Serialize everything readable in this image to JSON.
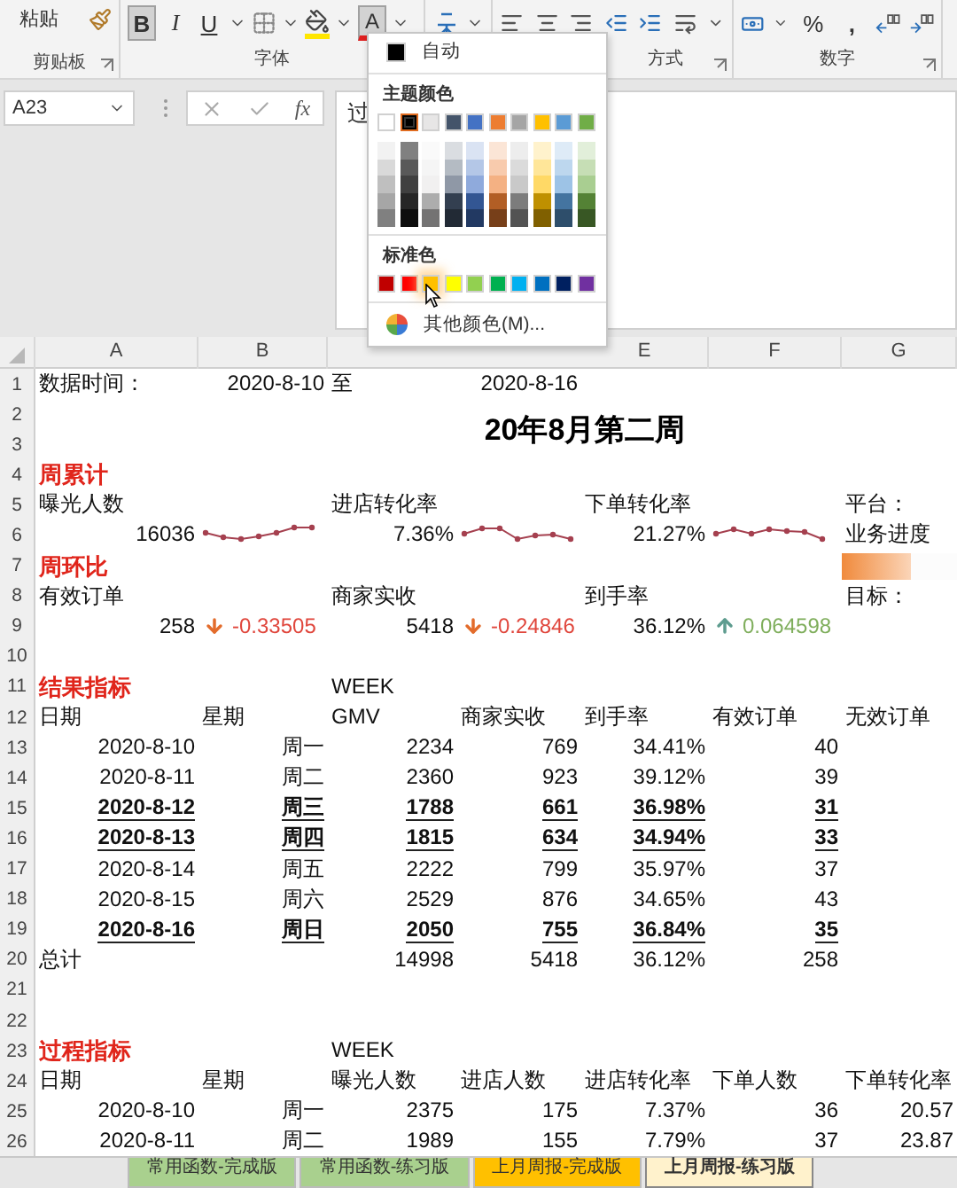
{
  "ribbon": {
    "paste_label": "粘贴",
    "font_buttons": [
      {
        "label": "B",
        "pressed": true
      },
      {
        "label": "I",
        "pressed": false
      },
      {
        "label": "U",
        "pressed": false
      }
    ],
    "font_color_label": "A",
    "percent_label": "%",
    "comma_label": ",",
    "groups": [
      {
        "label": "剪贴板"
      },
      {
        "label": "字体"
      },
      {
        "label": "方式"
      },
      {
        "label": "数字"
      }
    ]
  },
  "formula_bar": {
    "name_box": "A23",
    "fx_label": "fx",
    "formula": "过"
  },
  "color_menu": {
    "auto_label": "自动",
    "theme_title": "主题颜色",
    "theme_colors": [
      {
        "color": "#ffffff",
        "selected": false
      },
      {
        "color": "#000000",
        "selected": true
      },
      {
        "color": "#e7e6e6",
        "selected": false
      },
      {
        "color": "#44546a",
        "selected": false
      },
      {
        "color": "#4472c4",
        "selected": false
      },
      {
        "color": "#ed7d31",
        "selected": false
      },
      {
        "color": "#a5a5a5",
        "selected": false
      },
      {
        "color": "#ffc000",
        "selected": false
      },
      {
        "color": "#5b9bd5",
        "selected": false
      },
      {
        "color": "#70ad47",
        "selected": false
      }
    ],
    "standard_title": "标准色",
    "standard_colors": [
      {
        "color": "#c00000",
        "hovered": false
      },
      {
        "color": "#ff0000",
        "hovered": false
      },
      {
        "color": "#ffc000",
        "hovered": true
      },
      {
        "color": "#ffff00",
        "hovered": false
      },
      {
        "color": "#92d050",
        "hovered": false
      },
      {
        "color": "#00b050",
        "hovered": false
      },
      {
        "color": "#00b0f0",
        "hovered": false
      },
      {
        "color": "#0070c0",
        "hovered": false
      },
      {
        "color": "#002060",
        "hovered": false
      },
      {
        "color": "#7030a0",
        "hovered": false
      }
    ],
    "more_label": "其他颜色(M)..."
  },
  "column_headers": [
    "A",
    "B",
    "E",
    "F",
    "G"
  ],
  "rows": [
    {
      "num": "1",
      "highlighted": false,
      "cells": [
        {
          "kind": "label",
          "text": "数据时间："
        },
        {
          "kind": "number",
          "text": "2020-8-10"
        },
        {
          "kind": "label",
          "text": "至"
        },
        {
          "kind": "number",
          "text": "2020-8-16"
        }
      ]
    },
    {
      "num": "2",
      "cells": [
        {
          "kind": "empty"
        },
        {
          "kind": "empty"
        },
        {
          "kind": "title",
          "text": "20年8月第二周"
        }
      ]
    },
    {
      "num": "3"
    },
    {
      "num": "4",
      "cells": [
        {
          "kind": "heading",
          "text": "周累计"
        }
      ]
    },
    {
      "num": "5",
      "cells": [
        {
          "kind": "label",
          "text": "曝光人数"
        },
        {
          "kind": "empty"
        },
        {
          "kind": "label",
          "text": "进店转化率"
        },
        {
          "kind": "empty"
        },
        {
          "kind": "label",
          "text": "下单转化率"
        },
        {
          "kind": "empty"
        },
        {
          "kind": "label",
          "text": "平台："
        }
      ]
    },
    {
      "num": "6",
      "highlighted": false,
      "cells": [
        {
          "kind": "number",
          "text": "16036"
        },
        {
          "kind": "sparkline"
        },
        {
          "kind": "number",
          "text": "7.36%"
        },
        {
          "kind": "sparkline"
        },
        {
          "kind": "number",
          "text": "21.27%"
        },
        {
          "kind": "sparkline"
        },
        {
          "kind": "label",
          "text": "业务进度"
        }
      ]
    },
    {
      "num": "7",
      "cells": [
        {
          "kind": "heading",
          "text": "周环比"
        },
        {
          "kind": "empty"
        },
        {
          "kind": "empty"
        },
        {
          "kind": "empty"
        },
        {
          "kind": "empty"
        },
        {
          "kind": "empty"
        },
        {
          "kind": "databar",
          "level": 0.6
        }
      ]
    },
    {
      "num": "8",
      "cells": [
        {
          "kind": "label",
          "text": "有效订单"
        },
        {
          "kind": "empty"
        },
        {
          "kind": "label",
          "text": "商家实收"
        },
        {
          "kind": "empty"
        },
        {
          "kind": "label",
          "text": "到手率"
        },
        {
          "kind": "empty"
        },
        {
          "kind": "label",
          "text": "目标："
        }
      ]
    },
    {
      "num": "9",
      "highlighted": false,
      "cells": [
        {
          "kind": "number",
          "text": "258"
        },
        {
          "kind": "decrease",
          "color": "#e0463c",
          "text": "-0.33505"
        },
        {
          "kind": "number",
          "text": "5418"
        },
        {
          "kind": "decrease",
          "color": "#e0463c",
          "text": "-0.24846"
        },
        {
          "kind": "number",
          "text": "36.12%"
        },
        {
          "kind": "increase",
          "color": "#7fae5c",
          "text": "0.064598"
        }
      ]
    },
    {
      "num": "10"
    },
    {
      "num": "11",
      "cells": [
        {
          "kind": "heading",
          "text": "结果指标"
        },
        {
          "kind": "empty"
        },
        {
          "kind": "label",
          "text": "WEEK"
        }
      ]
    },
    {
      "num": "12",
      "cells": [
        {
          "kind": "label",
          "text": "日期"
        },
        {
          "kind": "label",
          "text": "星期"
        },
        {
          "kind": "label",
          "text": "GMV"
        },
        {
          "kind": "label",
          "text": "商家实收"
        },
        {
          "kind": "label",
          "text": "到手率"
        },
        {
          "kind": "label",
          "text": "有效订单"
        },
        {
          "kind": "label",
          "text": "无效订单"
        }
      ]
    },
    {
      "num": "13",
      "highlighted": false,
      "cells": [
        {
          "kind": "number",
          "text": "2020-8-10"
        },
        {
          "kind": "number",
          "text": "周一"
        },
        {
          "kind": "number",
          "text": "2234"
        },
        {
          "kind": "number",
          "text": "769"
        },
        {
          "kind": "number",
          "text": "34.41%"
        },
        {
          "kind": "number",
          "text": "40"
        }
      ]
    },
    {
      "num": "14",
      "highlighted": false,
      "cells": [
        {
          "kind": "number",
          "text": "2020-8-11"
        },
        {
          "kind": "number",
          "text": "周二"
        },
        {
          "kind": "number",
          "text": "2360"
        },
        {
          "kind": "number",
          "text": "923"
        },
        {
          "kind": "number",
          "text": "39.12%"
        },
        {
          "kind": "number",
          "text": "39"
        }
      ]
    },
    {
      "num": "15",
      "highlighted": true,
      "cells": [
        {
          "kind": "number",
          "text": "2020-8-12"
        },
        {
          "kind": "number",
          "text": "周三"
        },
        {
          "kind": "number",
          "text": "1788"
        },
        {
          "kind": "number",
          "text": "661"
        },
        {
          "kind": "number",
          "text": "36.98%"
        },
        {
          "kind": "number",
          "text": "31"
        }
      ]
    },
    {
      "num": "16",
      "highlighted": true,
      "cells": [
        {
          "kind": "number",
          "text": "2020-8-13"
        },
        {
          "kind": "number",
          "text": "周四"
        },
        {
          "kind": "number",
          "text": "1815"
        },
        {
          "kind": "number",
          "text": "634"
        },
        {
          "kind": "number",
          "text": "34.94%"
        },
        {
          "kind": "number",
          "text": "33"
        }
      ]
    },
    {
      "num": "17",
      "highlighted": false,
      "cells": [
        {
          "kind": "number",
          "text": "2020-8-14"
        },
        {
          "kind": "number",
          "text": "周五"
        },
        {
          "kind": "number",
          "text": "2222"
        },
        {
          "kind": "number",
          "text": "799"
        },
        {
          "kind": "number",
          "text": "35.97%"
        },
        {
          "kind": "number",
          "text": "37"
        }
      ]
    },
    {
      "num": "18",
      "highlighted": false,
      "cells": [
        {
          "kind": "number",
          "text": "2020-8-15"
        },
        {
          "kind": "number",
          "text": "周六"
        },
        {
          "kind": "number",
          "text": "2529"
        },
        {
          "kind": "number",
          "text": "876"
        },
        {
          "kind": "number",
          "text": "34.65%"
        },
        {
          "kind": "number",
          "text": "43"
        }
      ]
    },
    {
      "num": "19",
      "highlighted": true,
      "cells": [
        {
          "kind": "number",
          "text": "2020-8-16"
        },
        {
          "kind": "number",
          "text": "周日"
        },
        {
          "kind": "number",
          "text": "2050"
        },
        {
          "kind": "number",
          "text": "755"
        },
        {
          "kind": "number",
          "text": "36.84%"
        },
        {
          "kind": "number",
          "text": "35"
        }
      ]
    },
    {
      "num": "20",
      "highlighted": false,
      "cells": [
        {
          "kind": "label",
          "text": "总计"
        },
        {
          "kind": "empty"
        },
        {
          "kind": "number",
          "text": "14998"
        },
        {
          "kind": "number",
          "text": "5418"
        },
        {
          "kind": "number",
          "text": "36.12%"
        },
        {
          "kind": "number",
          "text": "258"
        }
      ]
    },
    {
      "num": "21"
    },
    {
      "num": "22"
    },
    {
      "num": "23",
      "cells": [
        {
          "kind": "heading",
          "text": "过程指标"
        },
        {
          "kind": "empty"
        },
        {
          "kind": "label",
          "text": "WEEK"
        }
      ]
    },
    {
      "num": "24",
      "cells": [
        {
          "kind": "label",
          "text": "日期"
        },
        {
          "kind": "label",
          "text": "星期"
        },
        {
          "kind": "label",
          "text": "曝光人数"
        },
        {
          "kind": "label",
          "text": "进店人数"
        },
        {
          "kind": "label",
          "text": "进店转化率"
        },
        {
          "kind": "label",
          "text": "下单人数"
        },
        {
          "kind": "label",
          "text": "下单转化率"
        }
      ]
    },
    {
      "num": "25",
      "highlighted": false,
      "cells": [
        {
          "kind": "number",
          "text": "2020-8-10"
        },
        {
          "kind": "number",
          "text": "周一"
        },
        {
          "kind": "number",
          "text": "2375"
        },
        {
          "kind": "number",
          "text": "175"
        },
        {
          "kind": "number",
          "text": "7.37%"
        },
        {
          "kind": "number",
          "text": "36"
        },
        {
          "kind": "number",
          "text": "20.57"
        }
      ]
    },
    {
      "num": "26",
      "highlighted": false,
      "cells": [
        {
          "kind": "number",
          "text": "2020-8-11"
        },
        {
          "kind": "number",
          "text": "周二"
        },
        {
          "kind": "number",
          "text": "1989"
        },
        {
          "kind": "number",
          "text": "155"
        },
        {
          "kind": "number",
          "text": "7.79%"
        },
        {
          "kind": "number",
          "text": "37"
        },
        {
          "kind": "number",
          "text": "23.87"
        }
      ]
    }
  ],
  "sheet_tabs": [
    {
      "label": "常用函数-完成版",
      "color": "#a9d08e",
      "selected": false
    },
    {
      "label": "常用函数-练习版",
      "color": "#a9d08e",
      "selected": false
    },
    {
      "label": "上月周报-完成版",
      "color": "#ffc000",
      "selected": false
    },
    {
      "label": "上月周报-练习版",
      "color": "#fff2cc",
      "selected": true
    }
  ]
}
